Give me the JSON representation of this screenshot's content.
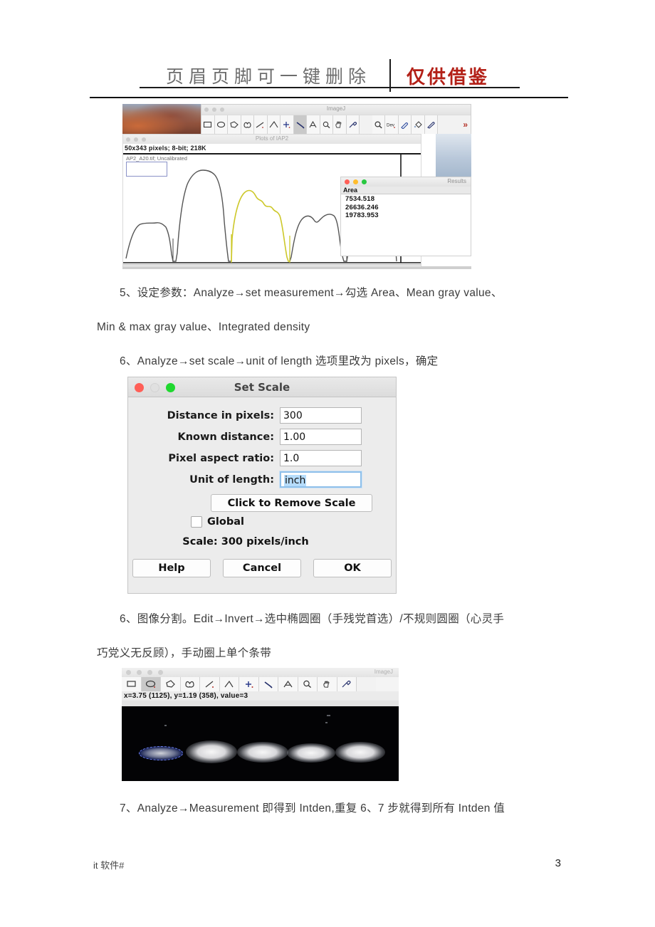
{
  "header": {
    "watermark_left": "页眉页脚可一键删除",
    "watermark_right": "仅供借鉴",
    "watermark_left_color": "#6d6d6d",
    "watermark_right_color": "#b32017"
  },
  "screenshot_imagej": {
    "window_title": "ImageJ",
    "toolbar_icons": [
      "rectangle-tool-icon",
      "oval-tool-icon",
      "polygon-tool-icon",
      "freehand-tool-icon",
      "line-tool-icon",
      "angle-tool-icon",
      "point-tool-icon",
      "wand-tool-icon",
      "text-tool-icon",
      "magnifier-tool-icon",
      "hand-tool-icon",
      "dropper-tool-icon",
      "zoom-tool-icon",
      "dev-tool-icon",
      "brush-tool-icon",
      "flood-fill-tool-icon",
      "spray-tool-icon"
    ],
    "toolbar_overflow": "»",
    "plots_window": {
      "title": "Plots of IAP2",
      "status_line": "50x343 pixels; 8-bit; 218K",
      "sub_line": "AP2_A20.tif; Uncalibrated"
    },
    "results_window": {
      "title": "Results",
      "column_header": "Area",
      "values": [
        "7534.518",
        "26636.246",
        "19783.953"
      ]
    }
  },
  "paragraphs": {
    "step5_line1": "5、设定参数：Analyze→set measurement→勾选 Area、Mean gray value、",
    "step5_line2": "Min & max gray value、Integrated density",
    "step6_scale": "6、Analyze→set scale→unit of length 选项里改为 pixels，确定",
    "step6_split_line1": "6、图像分割。Edit→Invert→选中椭圆圈（手残党首选）/不规则圆圈（心灵手",
    "step6_split_line2": "巧党义无反顾），手动圈上单个条带",
    "step7": "7、Analyze→Measurement 即得到 Intden,重复 6、7 步就得到所有 Intden 值"
  },
  "set_scale_dialog": {
    "title": "Set Scale",
    "fields": [
      {
        "label": "Distance in pixels:",
        "value": "300",
        "focused": false
      },
      {
        "label": "Known distance:",
        "value": "1.00",
        "focused": false
      },
      {
        "label": "Pixel aspect ratio:",
        "value": "1.0",
        "focused": false
      },
      {
        "label": "Unit of length:",
        "value": "inch",
        "focused": true
      }
    ],
    "remove_scale_button": "Click to Remove Scale",
    "global_label": "Global",
    "global_checked": false,
    "scale_text": "Scale: 300 pixels/inch",
    "buttons": [
      "Help",
      "Cancel",
      "OK"
    ]
  },
  "screenshot_gel": {
    "window_title": "ImageJ",
    "status_line": "x=3.75 (1125), y=1.19 (358), value=3",
    "toolbar_icons": [
      "rectangle-tool-icon",
      "oval-tool-icon",
      "polygon-tool-icon",
      "freehand-tool-icon",
      "line-tool-icon",
      "angle-tool-icon",
      "point-tool-icon",
      "wand-tool-icon",
      "text-tool-icon",
      "magnifier-tool-icon",
      "hand-tool-icon",
      "dropper-tool-icon"
    ],
    "band_count": 5,
    "selected_band_index": 1,
    "selection_shape": "ellipse"
  },
  "footer": {
    "left": "it 软件#",
    "page_number": "3"
  }
}
